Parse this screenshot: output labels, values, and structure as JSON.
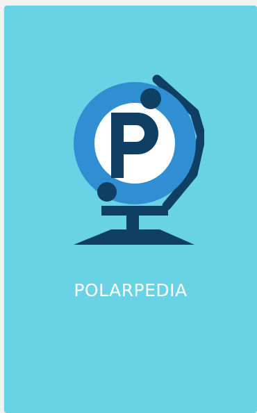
{
  "card": {
    "app_name": "POLARPEDIA",
    "logo_icon": "globe-letter-p-icon"
  },
  "colors": {
    "card_background": "#69d3e6",
    "globe_ring": "#2f8fd2",
    "dark_navy": "#0f3f63",
    "text": "#ffffff"
  }
}
